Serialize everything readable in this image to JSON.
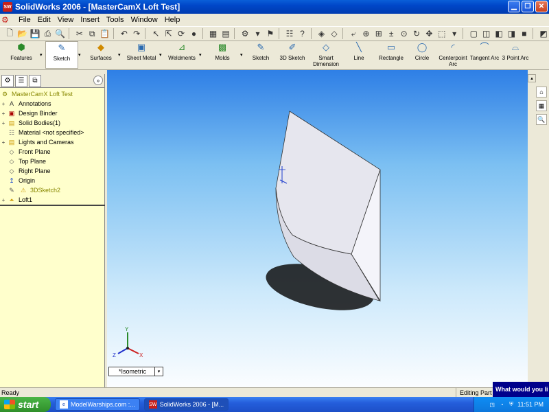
{
  "window": {
    "title": "SolidWorks 2006 - [MasterCamX Loft Test]",
    "app_icon": "SW"
  },
  "menu": [
    "File",
    "Edit",
    "View",
    "Insert",
    "Tools",
    "Window",
    "Help"
  ],
  "command_manager": [
    {
      "label": "Features",
      "icon": "features-icon"
    },
    {
      "label": "Sketch",
      "icon": "sketch-icon",
      "active": true
    },
    {
      "label": "Surfaces",
      "icon": "surfaces-icon"
    },
    {
      "label": "Sheet Metal",
      "icon": "sheet-metal-icon"
    },
    {
      "label": "Weldments",
      "icon": "weldments-icon"
    },
    {
      "label": "Molds",
      "icon": "molds-icon"
    },
    {
      "label": "Sketch",
      "icon": "sketch-tool-icon"
    },
    {
      "label": "3D Sketch",
      "icon": "3d-sketch-icon"
    },
    {
      "label": "Smart Dimension",
      "icon": "smart-dimension-icon"
    },
    {
      "label": "Line",
      "icon": "line-icon"
    },
    {
      "label": "Rectangle",
      "icon": "rectangle-icon"
    },
    {
      "label": "Circle",
      "icon": "circle-icon"
    },
    {
      "label": "Centerpoint Arc",
      "icon": "centerpoint-arc-icon"
    },
    {
      "label": "Tangent Arc",
      "icon": "tangent-arc-icon"
    },
    {
      "label": "3 Point Arc",
      "icon": "3-point-arc-icon"
    }
  ],
  "feature_tree": {
    "root": "MasterCamX Loft Test",
    "items": [
      {
        "label": "Annotations",
        "expandable": true
      },
      {
        "label": "Design Binder",
        "expandable": true
      },
      {
        "label": "Solid Bodies(1)",
        "expandable": true
      },
      {
        "label": "Material <not specified>",
        "expandable": false
      },
      {
        "label": "Lights and Cameras",
        "expandable": true
      },
      {
        "label": "Front Plane",
        "expandable": false
      },
      {
        "label": "Top Plane",
        "expandable": false
      },
      {
        "label": "Right Plane",
        "expandable": false
      },
      {
        "label": "Origin",
        "expandable": false
      },
      {
        "label": "3DSketch2",
        "expandable": false,
        "warning": true
      },
      {
        "label": "Loft1",
        "expandable": true
      }
    ]
  },
  "viewport": {
    "view_orientation": "*Isometric",
    "triad_labels": {
      "x": "X",
      "y": "Y",
      "z": "Z"
    }
  },
  "status": {
    "left": "Ready",
    "mode": "Editing Part",
    "balloon": "What would you li"
  },
  "taskbar": {
    "start": "start",
    "items": [
      {
        "label": "ModelWarships.com :...",
        "active": false
      },
      {
        "label": "SolidWorks 2006 - [M...",
        "active": true
      }
    ],
    "clock": "11:51 PM"
  }
}
